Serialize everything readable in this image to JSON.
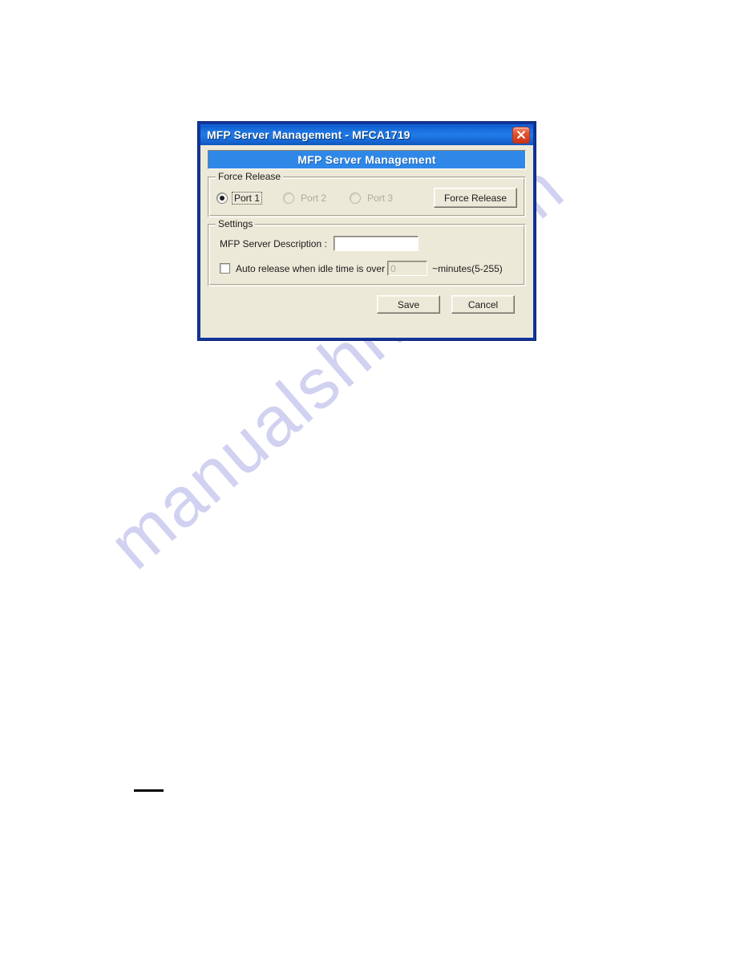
{
  "page": {
    "watermark_text": "manualshive.com"
  },
  "dialog": {
    "titlebar": {
      "title": "MFP Server Management - MFCA1719",
      "close_icon": "close-icon"
    },
    "banner": {
      "text": "MFP Server Management",
      "color": "#2f88e8"
    },
    "force_release": {
      "group_title": "Force Release",
      "ports": [
        {
          "label": "Port 1",
          "selected": true,
          "disabled": false,
          "focused": true
        },
        {
          "label": "Port 2",
          "selected": false,
          "disabled": true,
          "focused": false
        },
        {
          "label": "Port 3",
          "selected": false,
          "disabled": true,
          "focused": false
        }
      ],
      "button_label": "Force Release"
    },
    "settings": {
      "group_title": "Settings",
      "description_label": "MFP Server Description :",
      "description_value": "",
      "description_placeholder": "",
      "auto_release_label": "Auto release when idle time is over",
      "auto_release_checked": false,
      "idle_minutes_value": "0",
      "idle_minutes_disabled": true,
      "units_label": "~minutes(5-255)"
    },
    "footer": {
      "save_label": "Save",
      "cancel_label": "Cancel"
    }
  }
}
